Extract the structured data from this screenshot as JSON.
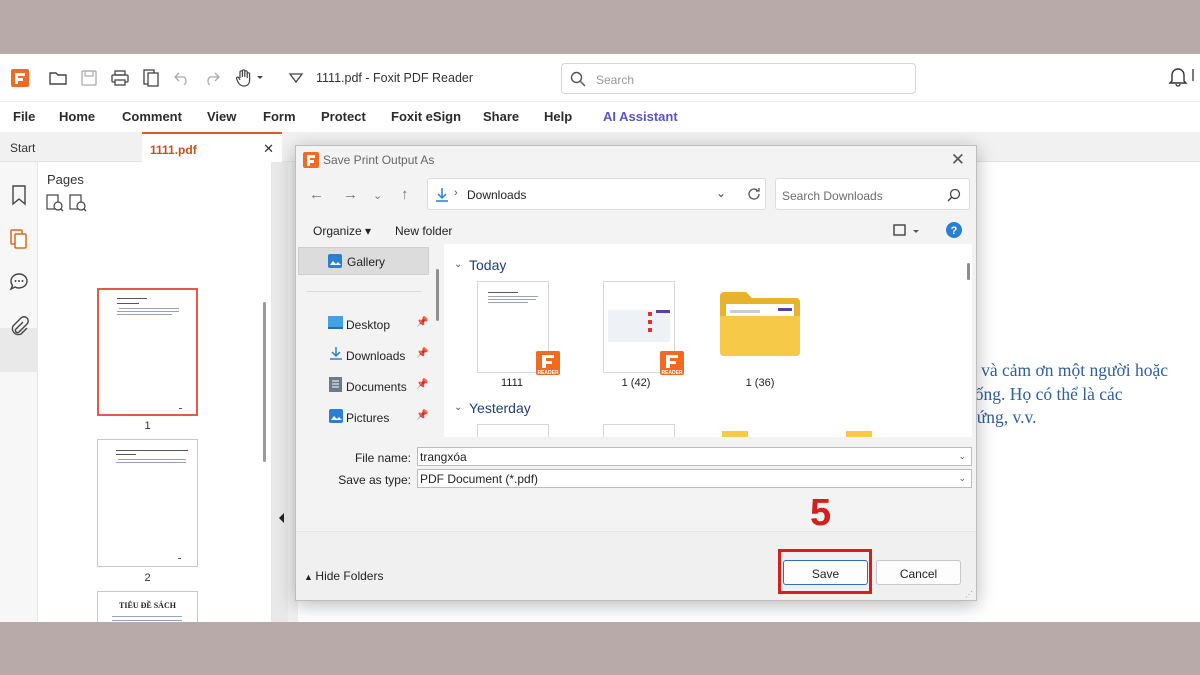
{
  "window": {
    "title": "1111.pdf - Foxit PDF Reader",
    "search_placeholder": "Search"
  },
  "menu": [
    "File",
    "Home",
    "Comment",
    "View",
    "Form",
    "Protect",
    "Foxit eSign",
    "Share",
    "Help",
    "AI Assistant"
  ],
  "tabs": [
    {
      "label": "Start"
    },
    {
      "label": "1111.pdf",
      "close": "✕"
    }
  ],
  "pages_panel": {
    "title": "Pages",
    "thumb_labels": [
      "1",
      "2"
    ],
    "thumb3_heading": "TIÊU ĐỀ SÁCH"
  },
  "document": {
    "lines": [
      "o và cảm ơn một người hoặc",
      "sống. Họ có thể là các",
      "nứng, v.v."
    ]
  },
  "dialog": {
    "title": "Save Print Output As",
    "close": "✕",
    "breadcrumb": "Downloads",
    "search_placeholder": "Search Downloads",
    "organize": "Organize ▾",
    "new_folder": "New folder",
    "nav": {
      "gallery": "Gallery",
      "items": [
        "Desktop",
        "Downloads",
        "Documents",
        "Pictures"
      ]
    },
    "groups": {
      "today": "Today",
      "yesterday": "Yesterday"
    },
    "files": [
      {
        "label": "1111"
      },
      {
        "label": "1 (42)"
      },
      {
        "label": "1 (36)"
      }
    ],
    "reader_badge": "READER",
    "file_name_label": "File name:",
    "file_name_value": "trangxóa",
    "save_type_label": "Save as type:",
    "save_type_value": "PDF Document (*.pdf)",
    "hide_folders": "Hide Folders",
    "save": "Save",
    "cancel": "Cancel"
  },
  "annotation": {
    "step": "5",
    "color": "#d81d1d"
  },
  "colors": {
    "foxit_orange": "#f06a22",
    "ai_purple": "#5b53c9",
    "doc_text": "#2f5e9c"
  }
}
